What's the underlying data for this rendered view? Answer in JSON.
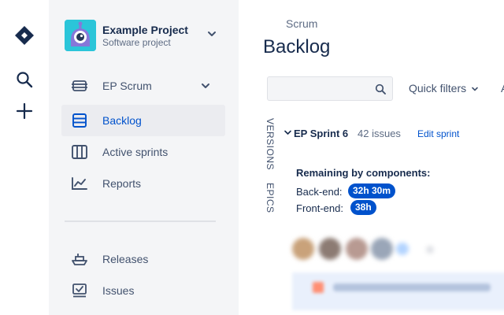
{
  "global_nav": {
    "logo_icon": "product-diamond-icon",
    "search_icon": "search-icon",
    "create_icon": "plus-icon"
  },
  "project": {
    "name": "Example Project",
    "type": "Software project",
    "avatar_icon": "robot-avatar-icon"
  },
  "sidebar": {
    "board_switcher": {
      "label": "EP Scrum",
      "icon": "board-icon"
    },
    "items": [
      {
        "label": "Backlog",
        "icon": "backlog-icon",
        "selected": true
      },
      {
        "label": "Active sprints",
        "icon": "columns-icon",
        "selected": false
      },
      {
        "label": "Reports",
        "icon": "chart-icon",
        "selected": false
      }
    ],
    "secondary_items": [
      {
        "label": "Releases",
        "icon": "ship-icon"
      },
      {
        "label": "Issues",
        "icon": "issues-icon"
      }
    ]
  },
  "main": {
    "breadcrumb": "Scrum",
    "title": "Backlog",
    "search": {
      "value": "",
      "placeholder": ""
    },
    "quick_filters_label": "Quick filters",
    "truncated_next": "A",
    "side_tabs": {
      "versions": "VERSIONS",
      "epics": "EPICS"
    },
    "sprint": {
      "name": "EP Sprint 6",
      "issue_count": "42 issues",
      "edit_label": "Edit sprint",
      "remaining_title": "Remaining by components:",
      "components": [
        {
          "label": "Back-end:",
          "value": "32h 30m"
        },
        {
          "label": "Front-end:",
          "value": "38h"
        }
      ]
    }
  },
  "colors": {
    "accent": "#0052cc",
    "sidebar_bg": "#f4f5f7",
    "selected_bg": "#ebecf0",
    "text": "#172b4d",
    "muted": "#5e6c84"
  }
}
